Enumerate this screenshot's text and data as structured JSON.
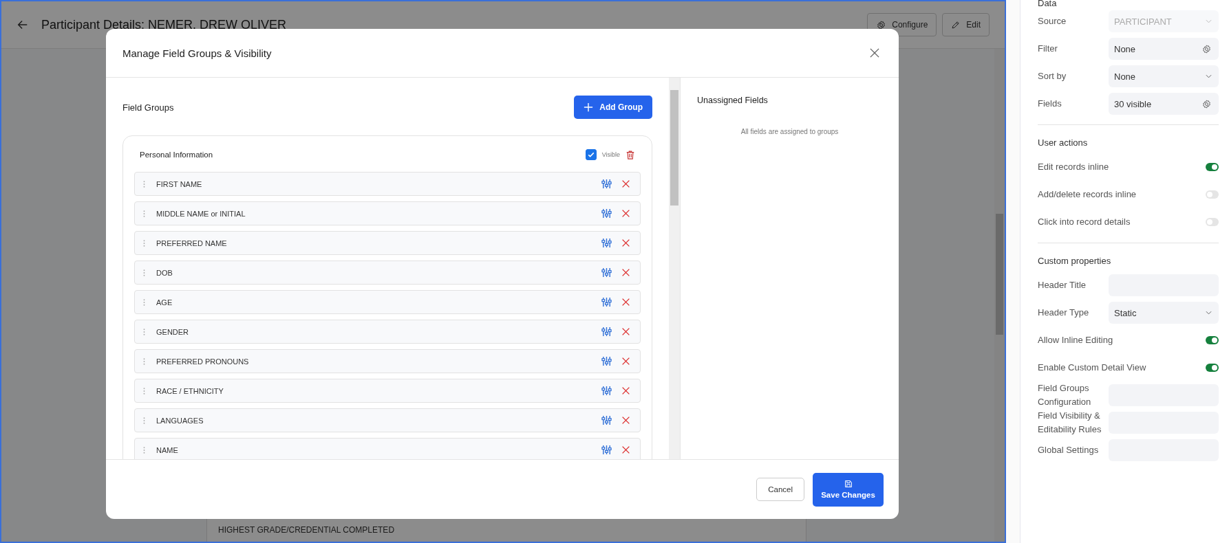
{
  "page": {
    "title": "Participant Details: NEMER. DREW OLIVER",
    "configure_label": "Configure",
    "edit_label": "Edit",
    "background_row": "HIGHEST GRADE/CREDENTIAL COMPLETED"
  },
  "modal": {
    "title": "Manage Field Groups & Visibility",
    "field_groups_heading": "Field Groups",
    "add_group_label": "Add Group",
    "groups": [
      {
        "name": "Personal Information",
        "visible": true,
        "visible_label": "Visible",
        "fields": [
          {
            "name": "FIRST NAME"
          },
          {
            "name": "MIDDLE NAME or INITIAL"
          },
          {
            "name": "PREFERRED NAME"
          },
          {
            "name": "DOB"
          },
          {
            "name": "AGE"
          },
          {
            "name": "GENDER"
          },
          {
            "name": "PREFERRED PRONOUNS"
          },
          {
            "name": "RACE / ETHNICITY"
          },
          {
            "name": "LANGUAGES"
          },
          {
            "name": "NAME"
          }
        ]
      }
    ],
    "unassigned": {
      "heading": "Unassigned Fields",
      "empty_text": "All fields are assigned to groups"
    },
    "cancel_label": "Cancel",
    "save_label": "Save Changes"
  },
  "panel": {
    "sections": [
      {
        "heading": "Data",
        "rows": [
          {
            "kind": "select",
            "label": "Source",
            "value": "PARTICIPANT",
            "disabled": true
          },
          {
            "kind": "gear",
            "label": "Filter",
            "value": "None",
            "disabled": false
          },
          {
            "kind": "select",
            "label": "Sort by",
            "value": "None",
            "disabled": false
          },
          {
            "kind": "gear",
            "label": "Fields",
            "value": "30 visible",
            "disabled": false
          }
        ]
      },
      {
        "heading": "User actions",
        "rows": [
          {
            "kind": "toggle",
            "label": "Edit records inline",
            "on": true
          },
          {
            "kind": "toggle",
            "label": "Add/delete records inline",
            "on": false
          },
          {
            "kind": "toggle",
            "label": "Click into record details",
            "on": false
          }
        ]
      },
      {
        "heading": "Custom properties",
        "rows": [
          {
            "kind": "text",
            "label": "Header Title"
          },
          {
            "kind": "select",
            "label": "Header Type",
            "value": "Static",
            "disabled": false
          },
          {
            "kind": "toggle",
            "label": "Allow Inline Editing",
            "on": true
          },
          {
            "kind": "toggle",
            "label": "Enable Custom Detail View",
            "on": true
          },
          {
            "kind": "text",
            "label": "Field Groups Configuration"
          },
          {
            "kind": "text",
            "label": "Field Visibility & Editability Rules"
          },
          {
            "kind": "text",
            "label": "Global Settings"
          }
        ]
      }
    ]
  }
}
